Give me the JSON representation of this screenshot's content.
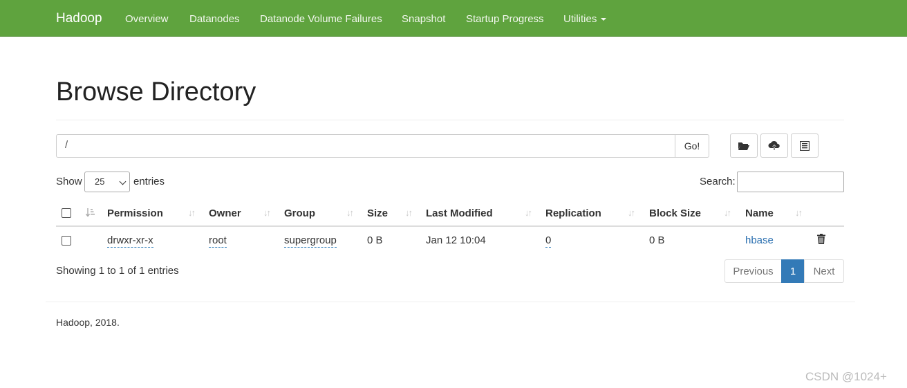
{
  "nav": {
    "brand": "Hadoop",
    "items": [
      "Overview",
      "Datanodes",
      "Datanode Volume Failures",
      "Snapshot",
      "Startup Progress",
      "Utilities"
    ]
  },
  "page": {
    "title": "Browse Directory",
    "path_value": "/",
    "go_label": "Go!"
  },
  "toolbar": {
    "icons": [
      "folder-open-icon",
      "cloud-upload-icon",
      "list-icon"
    ]
  },
  "table_controls": {
    "show_label": "Show",
    "entries_value": "25",
    "entries_label": "entries",
    "search_label": "Search:"
  },
  "table": {
    "headers": [
      "Permission",
      "Owner",
      "Group",
      "Size",
      "Last Modified",
      "Replication",
      "Block Size",
      "Name"
    ],
    "rows": [
      {
        "permission": "drwxr-xr-x",
        "owner": "root",
        "group": "supergroup",
        "size": "0 B",
        "last_modified": "Jan 12 10:04",
        "replication": "0",
        "block_size": "0 B",
        "name": "hbase"
      }
    ]
  },
  "pagination": {
    "info": "Showing 1 to 1 of 1 entries",
    "previous": "Previous",
    "page": "1",
    "next": "Next"
  },
  "footer": {
    "text": "Hadoop, 2018."
  },
  "watermark": "CSDN @1024+"
}
